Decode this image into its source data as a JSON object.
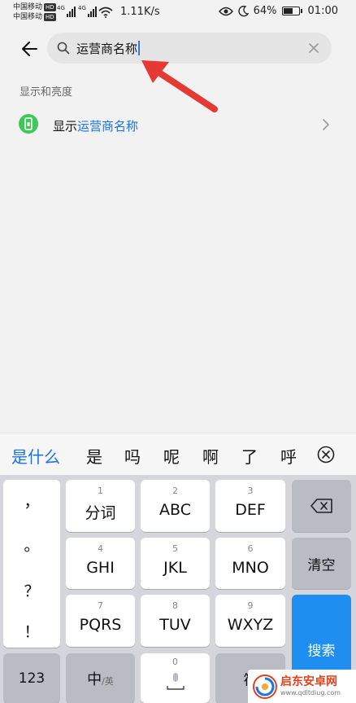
{
  "status_bar": {
    "carrier_1": "中国移动",
    "carrier_2": "中国移动",
    "hd": "HD",
    "net_type": "4G",
    "net_speed": "1.11K/s",
    "battery_percent": "64%",
    "battery_level": 0.64,
    "time": "01:00"
  },
  "search": {
    "query": "运营商名称",
    "icons": {
      "back": "arrow-left-icon",
      "search": "magnifier-icon",
      "clear": "close-icon"
    }
  },
  "results": {
    "section_title": "显示和亮度",
    "items": [
      {
        "prefix": "显示",
        "highlight": "运营商名称",
        "icon": "phone-icon"
      }
    ]
  },
  "ime": {
    "candidates": [
      "是什么",
      "是",
      "吗",
      "呢",
      "啊",
      "了",
      "呼"
    ],
    "punctuation": [
      "，",
      "。",
      "？",
      "！"
    ],
    "keys": [
      {
        "num": "1",
        "label": "分词"
      },
      {
        "num": "2",
        "label": "ABC"
      },
      {
        "num": "3",
        "label": "DEF"
      },
      {
        "num": "4",
        "label": "GHI"
      },
      {
        "num": "5",
        "label": "JKL"
      },
      {
        "num": "6",
        "label": "MNO"
      },
      {
        "num": "7",
        "label": "PQRS"
      },
      {
        "num": "8",
        "label": "TUV"
      },
      {
        "num": "9",
        "label": "WXYZ"
      }
    ],
    "clear_label": "清空",
    "search_label": "搜索",
    "num_mode_label": "123",
    "lang_main": "中",
    "lang_sub": "/英",
    "space_num": "0",
    "symbol_label": "符"
  },
  "watermark": {
    "title": "启东安卓网",
    "url": "www.qdltdiug.com"
  },
  "colors": {
    "accent": "#1a73e8",
    "search_key": "#1f8ef1",
    "result_icon": "#3ec85a",
    "annotation": "#e53935"
  }
}
